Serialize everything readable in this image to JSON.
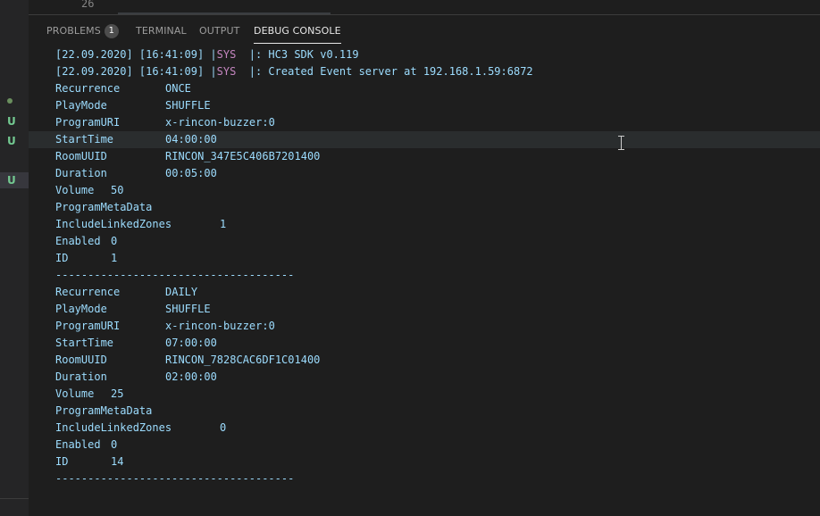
{
  "editor": {
    "line_number": "26"
  },
  "gutter": {
    "markers": [
      "U",
      "U",
      "U"
    ]
  },
  "panel": {
    "tabs": [
      {
        "label": "PROBLEMS",
        "badge": "1"
      },
      {
        "label": "TERMINAL"
      },
      {
        "label": "OUTPUT"
      },
      {
        "label": "DEBUG CONSOLE"
      }
    ]
  },
  "console": {
    "log": [
      {
        "time": "[22.09.2020] [16:41:09] |",
        "tag": "SYS",
        "msg": "  |: HC3 SDK v0.119"
      },
      {
        "time": "[22.09.2020] [16:41:09] |",
        "tag": "SYS",
        "msg": "  |: Created Event server at 192.168.1.59:6872"
      }
    ],
    "alarms": [
      {
        "rows": [
          {
            "key": "Recurrence",
            "value": "ONCE"
          },
          {
            "key": "PlayMode",
            "value": "SHUFFLE"
          },
          {
            "key": "ProgramURI",
            "value": "x-rincon-buzzer:0"
          },
          {
            "key": "StartTime",
            "value": "04:00:00"
          },
          {
            "key": "RoomUUID",
            "value": "RINCON_347E5C406B7201400"
          },
          {
            "key": "Duration",
            "value": "00:05:00"
          },
          {
            "key": "Volume",
            "value": "50"
          },
          {
            "key": "ProgramMetaData",
            "value": ""
          },
          {
            "key": "IncludeLinkedZones",
            "value": "1"
          },
          {
            "key": "Enabled",
            "value": "0"
          },
          {
            "key": "ID",
            "value": "1"
          }
        ],
        "separator": "-------------------------------------"
      },
      {
        "rows": [
          {
            "key": "Recurrence",
            "value": "DAILY"
          },
          {
            "key": "PlayMode",
            "value": "SHUFFLE"
          },
          {
            "key": "ProgramURI",
            "value": "x-rincon-buzzer:0"
          },
          {
            "key": "StartTime",
            "value": "07:00:00"
          },
          {
            "key": "RoomUUID",
            "value": "RINCON_7828CAC6DF1C01400"
          },
          {
            "key": "Duration",
            "value": "02:00:00"
          },
          {
            "key": "Volume",
            "value": "25"
          },
          {
            "key": "ProgramMetaData",
            "value": ""
          },
          {
            "key": "IncludeLinkedZones",
            "value": "0"
          },
          {
            "key": "Enabled",
            "value": "0"
          },
          {
            "key": "ID",
            "value": "14"
          }
        ],
        "separator": "-------------------------------------"
      }
    ]
  },
  "colors": {
    "background": "#1e1e1e",
    "console_text": "#9cdcfe",
    "sys_tag": "#c586c0",
    "git_untracked": "#73c991"
  }
}
